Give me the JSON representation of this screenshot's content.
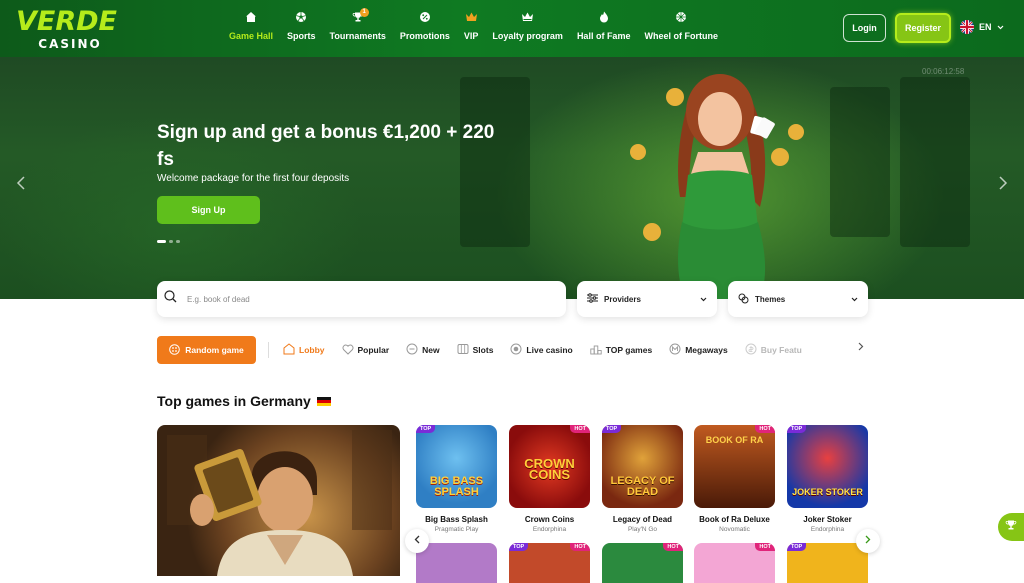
{
  "brand": {
    "name": "VERDE",
    "sub": "CASINO",
    "accent": "#b5ec1b",
    "header_bg": "#0f7a22"
  },
  "nav": {
    "items": [
      {
        "label": "Game Hall",
        "icon": "home-icon",
        "active": true
      },
      {
        "label": "Sports",
        "icon": "soccer-ball-icon"
      },
      {
        "label": "Tournaments",
        "icon": "trophy-icon",
        "badge": "1"
      },
      {
        "label": "Promotions",
        "icon": "gift-icon"
      },
      {
        "label": "VIP",
        "icon": "crown-icon"
      },
      {
        "label": "Loyalty program",
        "icon": "crown-outline-icon"
      },
      {
        "label": "Hall of Fame",
        "icon": "flame-icon"
      },
      {
        "label": "Wheel of Fortune",
        "icon": "wheel-icon"
      }
    ],
    "login_label": "Login",
    "register_label": "Register",
    "language": "EN"
  },
  "hero": {
    "title": "Sign up and get a bonus €1,200 + 220 fs",
    "subtitle": "Welcome package for the first four deposits",
    "cta_label": "Sign Up",
    "timer": "00:06:12:58",
    "slide_index": 1,
    "slide_count": 3
  },
  "search": {
    "placeholder": "E.g. book of dead",
    "providers_label": "Providers",
    "themes_label": "Themes"
  },
  "categories": {
    "random_label": "Random game",
    "items": [
      {
        "label": "Lobby",
        "icon": "lobby-icon",
        "active": true
      },
      {
        "label": "Popular",
        "icon": "heart-icon"
      },
      {
        "label": "New",
        "icon": "new-icon"
      },
      {
        "label": "Slots",
        "icon": "slots-icon"
      },
      {
        "label": "Live casino",
        "icon": "live-icon"
      },
      {
        "label": "TOP games",
        "icon": "podium-icon"
      },
      {
        "label": "Megaways",
        "icon": "megaways-icon"
      },
      {
        "label": "Buy Featu",
        "icon": "coin-icon"
      }
    ]
  },
  "section": {
    "title": "Top games in Germany",
    "games": [
      {
        "name": "Big Bass Splash",
        "provider": "Pragmatic Play",
        "tag": "TOP",
        "thumb_text": "BIG BASS SPLASH",
        "bg": "#2f7fc4",
        "fg": "#ffd23a"
      },
      {
        "name": "Crown Coins",
        "provider": "Endorphina",
        "tag": "HOT",
        "thumb_text": "CROWN COINS",
        "bg": "#b01414",
        "fg": "#ffcf3a"
      },
      {
        "name": "Legacy of Dead",
        "provider": "Play'N Go",
        "tag": "TOP",
        "thumb_text": "LEGACY OF DEAD",
        "bg": "#8a2e10",
        "fg": "#ffc83a"
      },
      {
        "name": "Book of Ra Deluxe",
        "provider": "Novomatic",
        "tag": "HOT",
        "thumb_text": "BOOK OF RA",
        "bg": "#5a2410",
        "fg": "#ffd14a"
      },
      {
        "name": "Joker Stoker",
        "provider": "Endorphina",
        "tag": "TOP",
        "thumb_text": "JOKER STOKER",
        "bg": "#1438a8",
        "fg": "#ffe34a"
      }
    ],
    "row2_tags": [
      "",
      "TOP",
      "HOT",
      "HOT",
      "TOP"
    ],
    "row2_tags_right": [
      "",
      "HOT",
      "",
      "HOT",
      ""
    ],
    "row2_colors": [
      "#b27ac8",
      "#c24a2a",
      "#2b8a3e",
      "#f3a6d4",
      "#f0b41c"
    ]
  }
}
